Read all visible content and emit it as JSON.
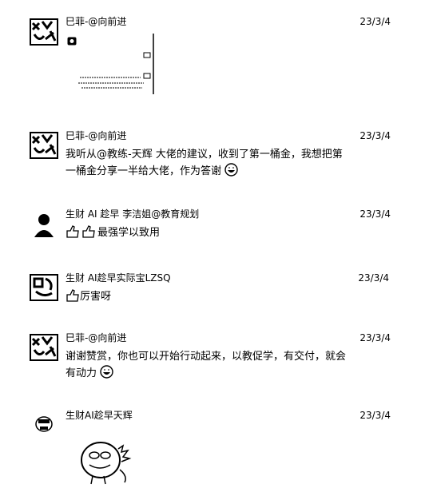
{
  "messages": [
    {
      "name": "巳菲-@向前进",
      "date": "23/3/4",
      "avatar_icon": "scribble-avatar-icon",
      "content_type": "image",
      "image_icon": "chat-image-icon"
    },
    {
      "name": "巳菲-@向前进",
      "date": "23/3/4",
      "avatar_icon": "scribble-avatar-icon",
      "text": "我听从@教练-天辉 大佬的建议，收到了第一桶金，我想把第一桶金分享一半给大佬，作为答谢",
      "emoji": "grin-emoji"
    },
    {
      "name": "生财 AI 趁早 李洁姐@教育规划",
      "date": "23/3/4",
      "avatar_icon": "person-avatar-icon",
      "text": "最强学以致用",
      "emoji_prefix": "thumbs-up-emoji"
    },
    {
      "name": "生财 AI趁早实际宝LZSQ",
      "date": "23/3/4",
      "avatar_icon": "pattern-avatar-icon",
      "text": "厉害呀",
      "emoji_prefix": "thumbs-up-emoji"
    },
    {
      "name": "巳菲-@向前进",
      "date": "23/3/4",
      "avatar_icon": "scribble-avatar-icon",
      "text": "谢谢赞赏，你也可以开始行动起来，以教促学，有交付，就会有动力",
      "emoji": "grin-emoji"
    },
    {
      "name": "生财AI趁早天辉",
      "date": "23/3/4",
      "avatar_icon": "cartoon-avatar-icon",
      "content_type": "sticker",
      "sticker_icon": "dinosaur-sticker-icon"
    }
  ]
}
